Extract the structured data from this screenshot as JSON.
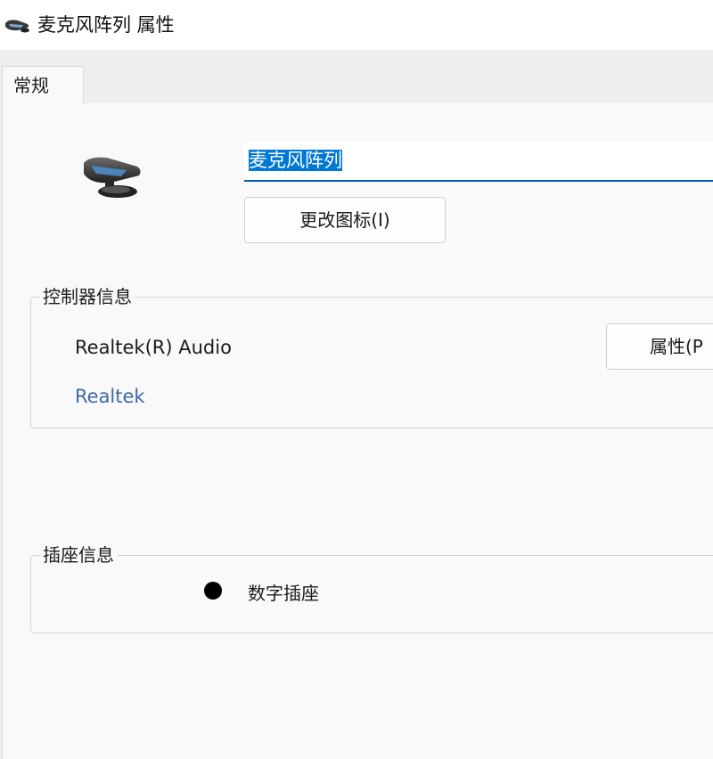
{
  "window": {
    "title": "麦克风阵列 属性",
    "icon": "webcam-microphone-icon"
  },
  "tabs": [
    {
      "label": "常规",
      "selected": true
    }
  ],
  "general": {
    "device_icon": "webcam-microphone-icon",
    "name_value": "麦克风阵列",
    "change_icon_button": "更改图标(I)"
  },
  "controller_info": {
    "legend": "控制器信息",
    "name": "Realtek(R) Audio",
    "manufacturer_link": "Realtek",
    "properties_button": "属性(P"
  },
  "jack_info": {
    "legend": "插座信息",
    "jack_label": "数字插座",
    "jack_color": "#000000"
  },
  "colors": {
    "accent": "#005fb8",
    "selection": "#0078d4",
    "link": "#3d6aa3"
  }
}
